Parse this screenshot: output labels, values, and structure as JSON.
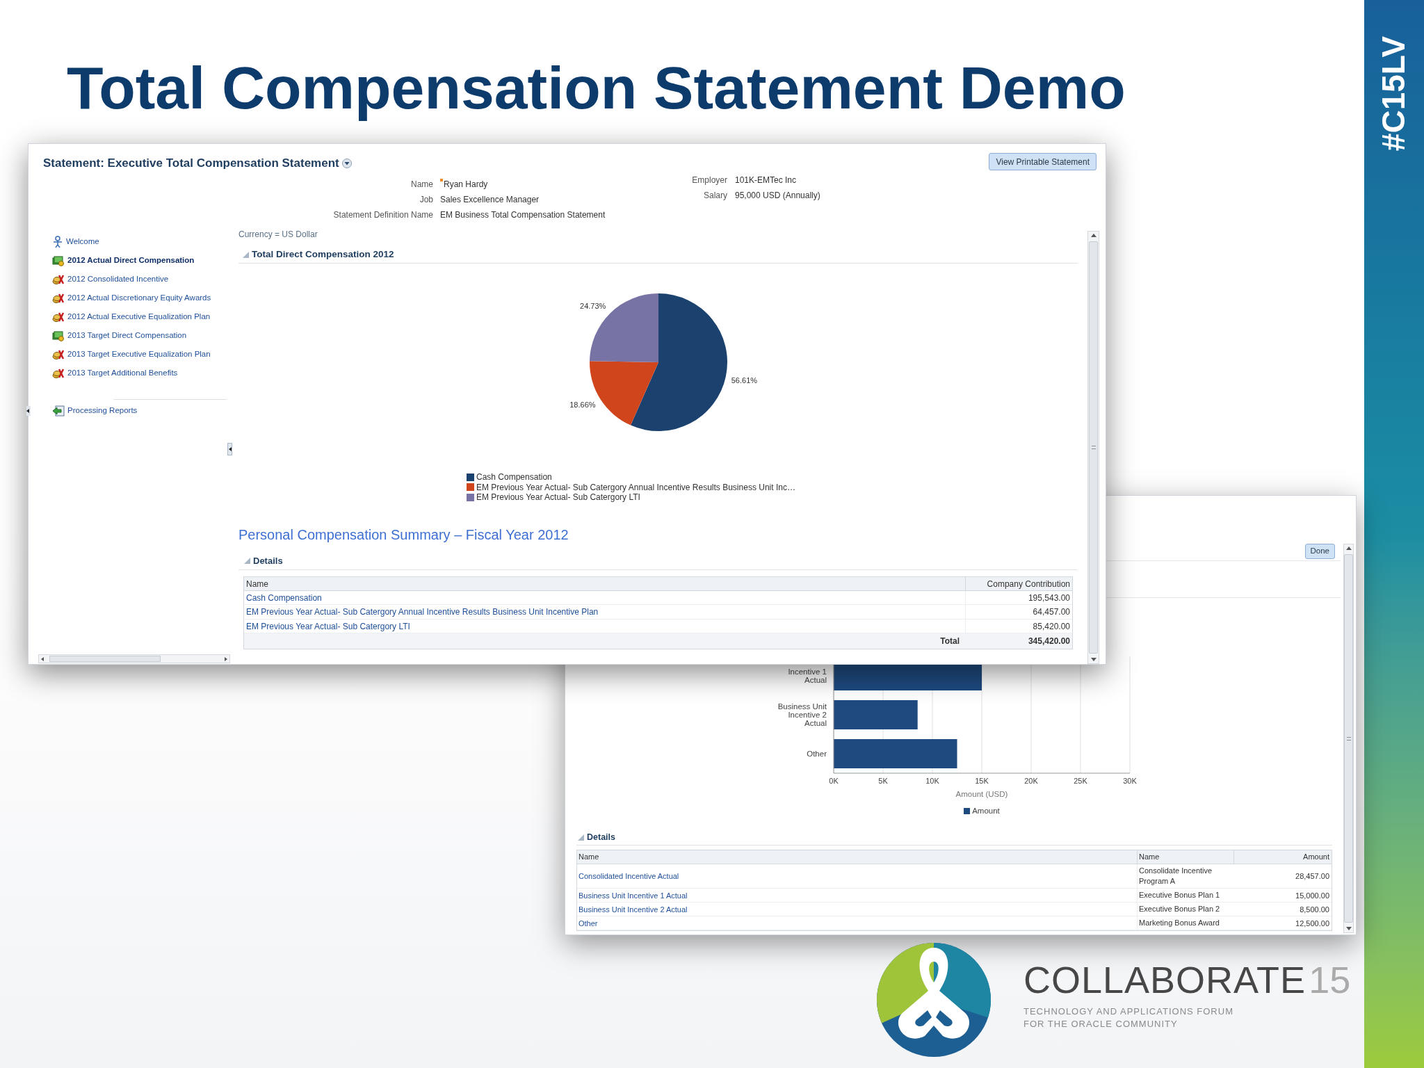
{
  "slide": {
    "title": "Total Compensation Statement Demo",
    "tag": "#C15LV"
  },
  "statement_window": {
    "title": "Statement: Executive Total Compensation Statement",
    "print_button": "View Printable Statement",
    "person_fields": [
      {
        "label": "Name",
        "value": "Ryan Hardy",
        "flagged": true
      },
      {
        "label": "Job",
        "value": "Sales Excellence Manager",
        "flagged": false
      },
      {
        "label": "Statement Definition Name",
        "value": "EM Business Total Compensation Statement",
        "flagged": false
      }
    ],
    "employer_fields": [
      {
        "label": "Employer",
        "value": "101K-EMTec Inc"
      },
      {
        "label": "Salary",
        "value": "95,000 USD (Annually)"
      }
    ],
    "nav": {
      "items": [
        {
          "label": "Welcome",
          "kind": "welcome",
          "selected": false
        },
        {
          "label": "2012 Actual Direct Compensation",
          "kind": "cash",
          "selected": true
        },
        {
          "label": "2012 Consolidated Incentive",
          "kind": "award",
          "selected": false
        },
        {
          "label": "2012 Actual Discretionary Equity Awards",
          "kind": "award",
          "selected": false
        },
        {
          "label": "2012 Actual Executive Equalization Plan",
          "kind": "award",
          "selected": false
        },
        {
          "label": "2013 Target Direct Compensation",
          "kind": "cash",
          "selected": false
        },
        {
          "label": "2013 Target Executive Equalization Plan",
          "kind": "award",
          "selected": false
        },
        {
          "label": "2013 Target Additional Benefits",
          "kind": "award",
          "selected": false
        }
      ],
      "footer_items": [
        {
          "label": "Processing Reports",
          "kind": "reports",
          "selected": false
        }
      ]
    },
    "currency": "Currency = US Dollar",
    "chart_section": {
      "title": "Total Direct Compensation 2012",
      "chart_data": {
        "type": "pie",
        "categories": [
          "Cash Compensation",
          "EM Previous Year Actual- Sub Catergory Annual Incentive Results Business Unit Inc…",
          "EM Previous Year Actual- Sub Catergory LTI"
        ],
        "colors": [
          "#1b416f",
          "#d0451b",
          "#7873a5"
        ],
        "values": [
          56.61,
          18.66,
          24.73
        ],
        "value_labels": [
          "56.61%",
          "18.66%",
          "24.73%"
        ],
        "legend": "bottom"
      }
    },
    "summary": {
      "title": "Personal Compensation Summary – Fiscal Year 2012",
      "details_label": "Details",
      "columns": [
        "Name",
        "Company Contribution"
      ],
      "rows": [
        {
          "name": "Cash Compensation",
          "amount": "195,543.00"
        },
        {
          "name": "EM Previous Year Actual- Sub Catergory Annual Incentive Results Business Unit Incentive Plan",
          "amount": "64,457.00"
        },
        {
          "name": "EM Previous Year Actual- Sub Catergory LTI",
          "amount": "85,420.00"
        }
      ],
      "total_label": "Total",
      "total_value": "345,420.00"
    }
  },
  "detail_window": {
    "done_button": "Done",
    "chart_data": {
      "type": "bar",
      "orientation": "horizontal",
      "categories": [
        "Incentive 1 Actual",
        "Business Unit Incentive 2 Actual",
        "Other"
      ],
      "series": [
        {
          "name": "Amount",
          "color": "#1e4a7f",
          "values": [
            15000,
            8500,
            12500
          ]
        }
      ],
      "xlim": [
        0,
        30000
      ],
      "xticks": [
        {
          "value": 0,
          "label": "0K"
        },
        {
          "value": 5000,
          "label": "5K"
        },
        {
          "value": 10000,
          "label": "10K"
        },
        {
          "value": 15000,
          "label": "15K"
        },
        {
          "value": 20000,
          "label": "20K"
        },
        {
          "value": 25000,
          "label": "25K"
        },
        {
          "value": 30000,
          "label": "30K"
        }
      ],
      "xlabel": "Amount (USD)",
      "grid": true
    },
    "details_label": "Details",
    "columns": [
      "Name",
      "Name",
      "Amount"
    ],
    "rows": [
      {
        "item": "Consolidated Incentive Actual",
        "plan": "Consolidate Incentive Program A",
        "amount": "28,457.00"
      },
      {
        "item": "Business Unit Incentive 1 Actual",
        "plan": "Executive Bonus Plan 1",
        "amount": "15,000.00"
      },
      {
        "item": "Business Unit Incentive 2 Actual",
        "plan": "Executive Bonus Plan 2",
        "amount": "8,500.00"
      },
      {
        "item": "Other",
        "plan": "Marketing Bonus Award",
        "amount": "12,500.00"
      }
    ]
  },
  "event": {
    "name": "COLLABORATE",
    "edition": "15",
    "tagline": [
      "TECHNOLOGY AND APPLICATIONS FORUM",
      "FOR THE ORACLE COMMUNITY"
    ]
  }
}
